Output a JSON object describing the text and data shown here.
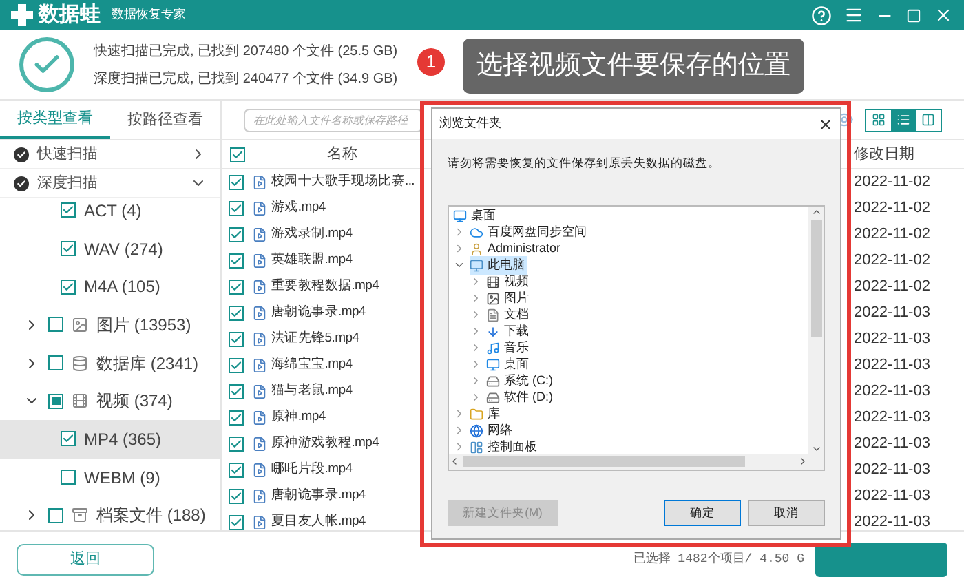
{
  "app": {
    "name": "数据蛙",
    "subtitle": "数据恢复专家"
  },
  "summary": {
    "lines": [
      "快速扫描已完成, 已找到 207480 个文件 (25.5 GB)",
      "深度扫描已完成, 已找到 240477 个文件 (34.9 GB)"
    ]
  },
  "callout": {
    "number": "1",
    "text": "选择视频文件要保存的位置"
  },
  "tabs": [
    {
      "label": "按类型查看",
      "selected": true
    },
    {
      "label": "按路径查看",
      "selected": false
    }
  ],
  "scans": [
    {
      "label": "快速扫描",
      "expanded": false
    },
    {
      "label": "深度扫描",
      "expanded": true
    }
  ],
  "tree": [
    {
      "label": "ACT (4)",
      "checked": true,
      "selected": false
    },
    {
      "label": "WAV (274)",
      "checked": true,
      "selected": false
    },
    {
      "label": "M4A (105)",
      "checked": true,
      "selected": false
    },
    {
      "label": "图片 (13953)",
      "kind": "image",
      "checked": false,
      "expanded": false,
      "selected": false
    },
    {
      "label": "数据库 (2341)",
      "kind": "database",
      "checked": false,
      "expanded": false,
      "selected": false
    },
    {
      "label": "视频 (374)",
      "kind": "video",
      "checked": false,
      "partial": true,
      "expanded": true,
      "selected": false,
      "children": [
        {
          "label": "MP4 (365)",
          "checked": true,
          "selected": true
        },
        {
          "label": "WEBM (9)",
          "checked": false,
          "selected": false
        }
      ]
    },
    {
      "label": "档案文件 (188)",
      "kind": "archive",
      "checked": false,
      "expanded": false,
      "selected": false
    }
  ],
  "search": {
    "placeholder": "在此处输入文件名称或保存路径"
  },
  "views": [
    {
      "kind": "grid",
      "selected": false
    },
    {
      "kind": "list",
      "selected": true
    },
    {
      "kind": "columns",
      "selected": false
    }
  ],
  "table": {
    "columns": [
      "名称",
      "修改日期"
    ],
    "all_checked": true,
    "rows": [
      {
        "name": "校园十大歌手现场比赛...",
        "date": "2022-11-02",
        "checked": true
      },
      {
        "name": "游戏.mp4",
        "date": "2022-11-02",
        "checked": true
      },
      {
        "name": "游戏录制.mp4",
        "date": "2022-11-02",
        "checked": true
      },
      {
        "name": "英雄联盟.mp4",
        "date": "2022-11-02",
        "checked": true
      },
      {
        "name": "重要教程数据.mp4",
        "date": "2022-11-02",
        "checked": true
      },
      {
        "name": "唐朝诡事录.mp4",
        "date": "2022-11-03",
        "checked": true
      },
      {
        "name": "法证先锋5.mp4",
        "date": "2022-11-03",
        "checked": true
      },
      {
        "name": "海绵宝宝.mp4",
        "date": "2022-11-03",
        "checked": true
      },
      {
        "name": "猫与老鼠.mp4",
        "date": "2022-11-03",
        "checked": true
      },
      {
        "name": "原神.mp4",
        "date": "2022-11-03",
        "checked": true
      },
      {
        "name": "原神游戏教程.mp4",
        "date": "2022-11-03",
        "checked": true
      },
      {
        "name": "哪吒片段.mp4",
        "date": "2022-11-03",
        "checked": true
      },
      {
        "name": "唐朝诡事录.mp4",
        "date": "2022-11-03",
        "checked": true
      },
      {
        "name": "夏目友人帐.mp4",
        "date": "2022-11-03",
        "checked": true
      }
    ]
  },
  "footer": {
    "back": "返回",
    "status": "已选择 1482个项目/ 4.50 G"
  },
  "dialog": {
    "title": "浏览文件夹",
    "message": "请勿将需要恢复的文件保存到原丢失数据的磁盘。",
    "tree": [
      {
        "label": "桌面",
        "kind": "desktop",
        "selected": false,
        "children": [
          {
            "label": "百度网盘同步空间",
            "kind": "cloud",
            "selected": false,
            "expanded": false
          },
          {
            "label": "Administrator",
            "kind": "user",
            "selected": false,
            "expanded": false
          },
          {
            "label": "此电脑",
            "kind": "pc",
            "selected": true,
            "expanded": true,
            "children": [
              {
                "label": "视频",
                "kind": "video",
                "selected": false,
                "expanded": false
              },
              {
                "label": "图片",
                "kind": "image",
                "selected": false,
                "expanded": false
              },
              {
                "label": "文档",
                "kind": "doc",
                "selected": false,
                "expanded": false
              },
              {
                "label": "下载",
                "kind": "download",
                "selected": false,
                "expanded": false
              },
              {
                "label": "音乐",
                "kind": "music",
                "selected": false,
                "expanded": false
              },
              {
                "label": "桌面",
                "kind": "desktop",
                "selected": false,
                "expanded": false
              },
              {
                "label": "系统 (C:)",
                "kind": "drive",
                "selected": false,
                "expanded": false
              },
              {
                "label": "软件 (D:)",
                "kind": "drive",
                "selected": false,
                "expanded": false
              }
            ]
          },
          {
            "label": "库",
            "kind": "library",
            "selected": false,
            "expanded": false
          },
          {
            "label": "网络",
            "kind": "network",
            "selected": false,
            "expanded": false
          },
          {
            "label": "控制面板",
            "kind": "control",
            "selected": false,
            "expanded": false
          }
        ]
      }
    ],
    "buttons": [
      {
        "label": "新建文件夹(M)",
        "disabled": true,
        "default": false
      },
      {
        "label": "确定",
        "disabled": false,
        "default": true
      },
      {
        "label": "取消",
        "disabled": false,
        "default": false
      }
    ]
  }
}
